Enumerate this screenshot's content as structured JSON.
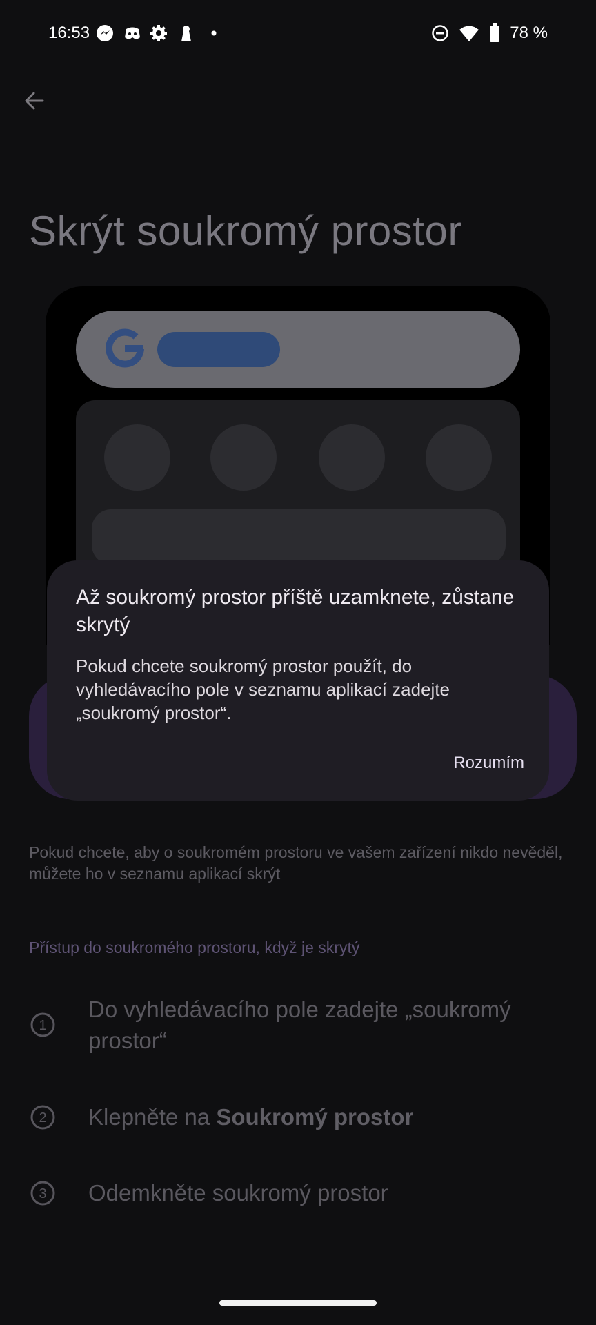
{
  "status_bar": {
    "time": "16:53",
    "battery": "78 %",
    "left_icons": [
      "messenger-icon",
      "discord-icon",
      "settings-gear-icon",
      "keyhole-icon",
      "dot-icon"
    ],
    "right_icons": [
      "do-not-disturb-icon",
      "wifi-icon",
      "battery-icon"
    ]
  },
  "page": {
    "title": "Skrýt soukromý prostor",
    "description": "Pokud chcete, aby o soukromém prostoru ve vašem zařízení nikdo nevěděl, můžete ho v seznamu aplikací skrýt",
    "section_heading": "Přístup do soukromého prostoru, když je skrytý",
    "steps": [
      {
        "number": "1",
        "text": "Do vyhledávacího pole zadejte „soukromý prostor“"
      },
      {
        "number": "2",
        "text_plain": "Klepněte na ",
        "text_bold": "Soukromý prostor"
      },
      {
        "number": "3",
        "text": "Odemkněte soukromý prostor"
      }
    ]
  },
  "dialog": {
    "title": "Až soukromý prostor příště uzamknete, zůstane skrytý",
    "body": "Pokud chcete soukromý prostor použít, do vyhledávacího pole v seznamu aplikací zadejte „soukromý prostor“.",
    "button": "Rozumím"
  },
  "colors": {
    "background": "#0f0f11",
    "dialog": "#1f1d24",
    "accent_purple": "#5e5374",
    "search_fill": "#2f4a78"
  }
}
